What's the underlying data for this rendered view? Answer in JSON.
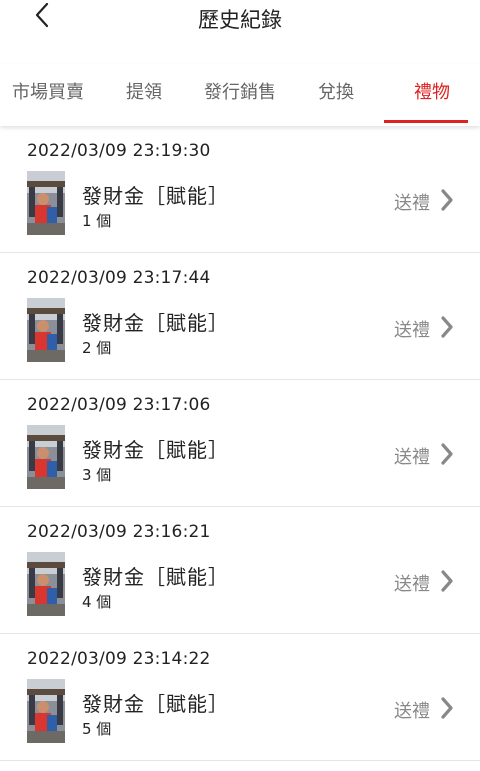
{
  "header": {
    "title": "歷史紀錄",
    "back_icon": "chevron-left-icon"
  },
  "tabs": [
    {
      "label": "市場買賣",
      "active": false
    },
    {
      "label": "提領",
      "active": false
    },
    {
      "label": "發行銷售",
      "active": false
    },
    {
      "label": "兌換",
      "active": false
    },
    {
      "label": "禮物",
      "active": true
    }
  ],
  "colors": {
    "accent": "#e02020",
    "secondary_text": "#888888",
    "divider": "#e6e6e6"
  },
  "records": [
    {
      "time": "2022/03/09 23:19:30",
      "name": "發財金［賦能］",
      "qty": "1 個",
      "action": "送禮",
      "thumbnail": "photo-thumbnail",
      "action_icon": "chevron-right-icon"
    },
    {
      "time": "2022/03/09 23:17:44",
      "name": "發財金［賦能］",
      "qty": "2 個",
      "action": "送禮",
      "thumbnail": "photo-thumbnail",
      "action_icon": "chevron-right-icon"
    },
    {
      "time": "2022/03/09 23:17:06",
      "name": "發財金［賦能］",
      "qty": "3 個",
      "action": "送禮",
      "thumbnail": "photo-thumbnail",
      "action_icon": "chevron-right-icon"
    },
    {
      "time": "2022/03/09 23:16:21",
      "name": "發財金［賦能］",
      "qty": "4 個",
      "action": "送禮",
      "thumbnail": "photo-thumbnail",
      "action_icon": "chevron-right-icon"
    },
    {
      "time": "2022/03/09 23:14:22",
      "name": "發財金［賦能］",
      "qty": "5 個",
      "action": "送禮",
      "thumbnail": "photo-thumbnail",
      "action_icon": "chevron-right-icon"
    }
  ]
}
